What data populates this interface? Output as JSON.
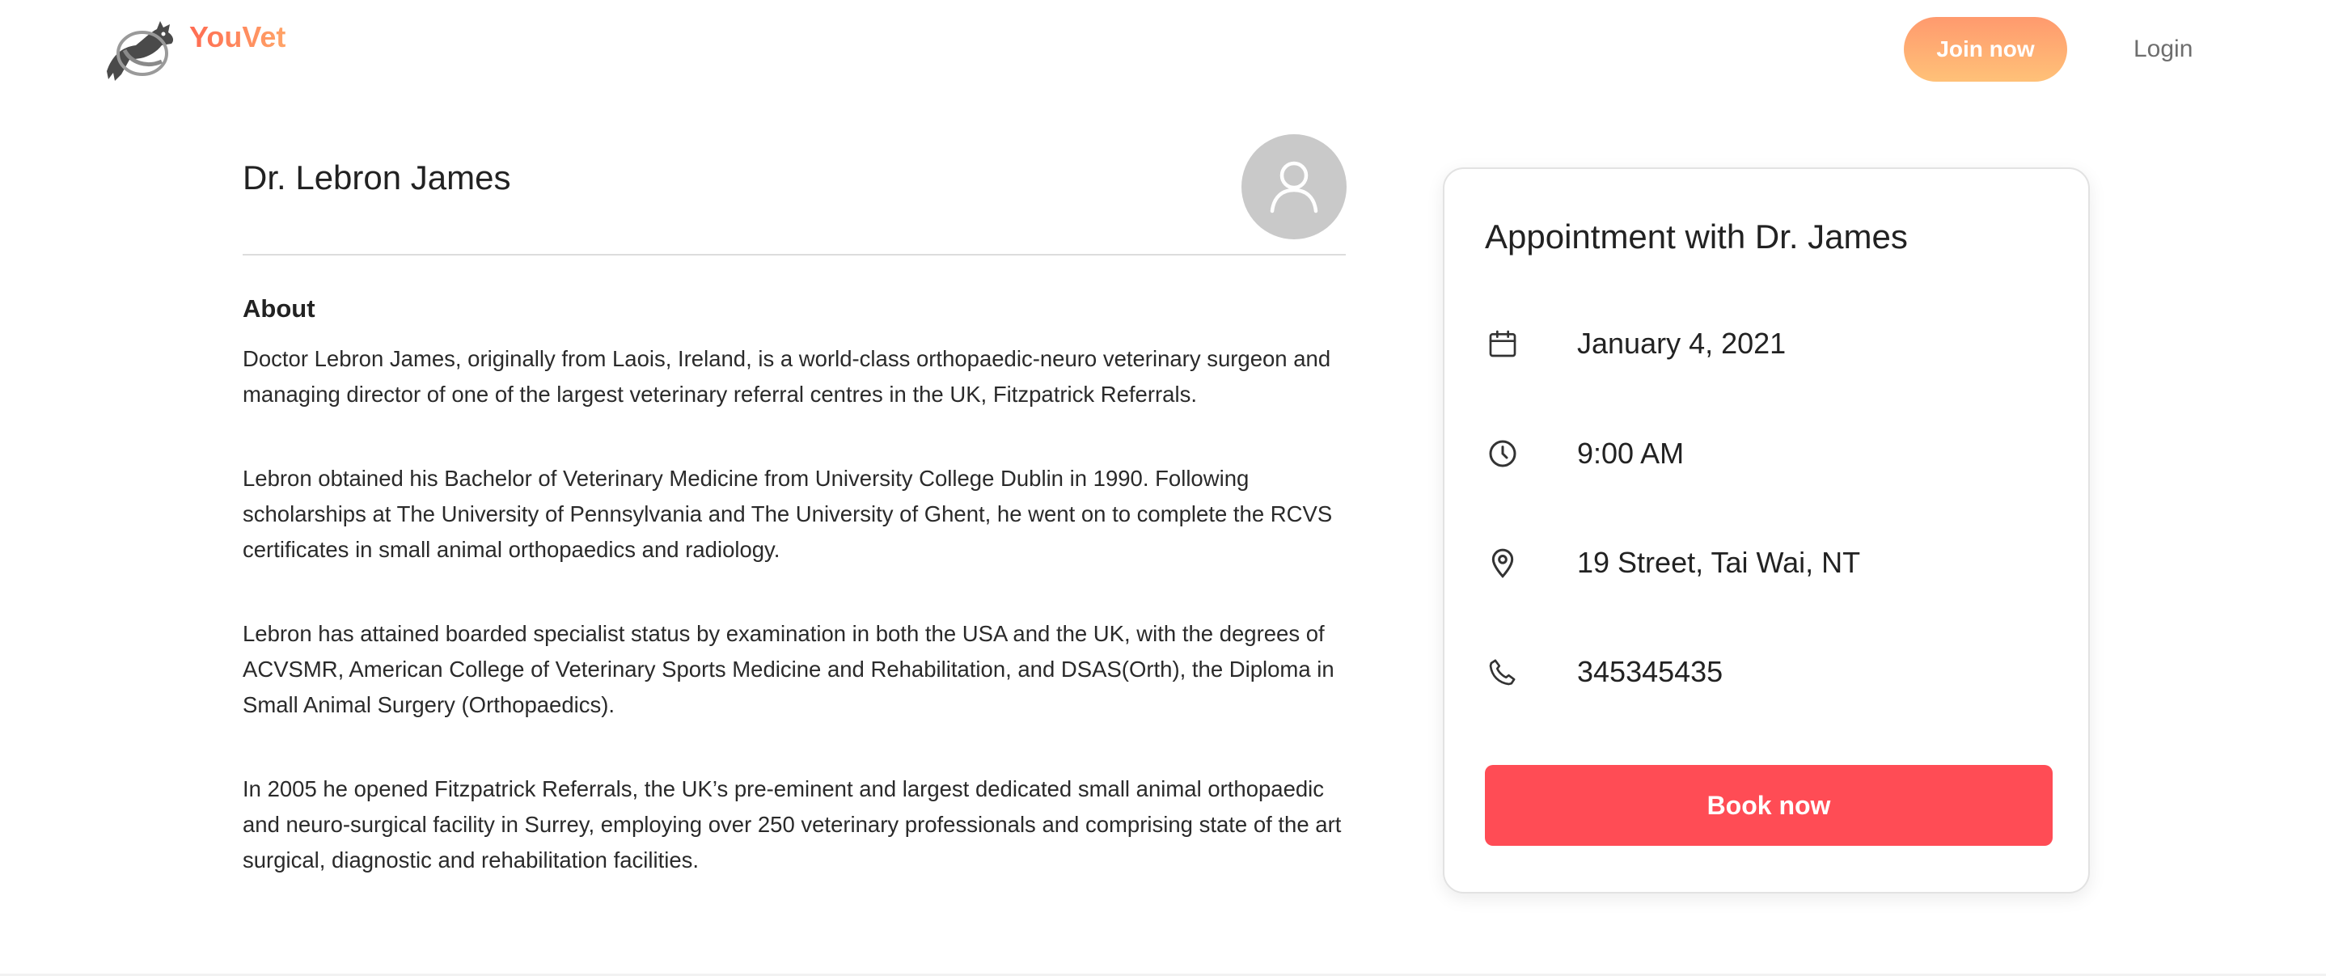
{
  "header": {
    "brand": "YouVet",
    "join_label": "Join now",
    "login_label": "Login"
  },
  "doctor": {
    "name": "Dr. Lebron James",
    "about_heading": "About",
    "about_paragraphs": [
      "Doctor Lebron James, originally from Laois, Ireland, is a world-class orthopaedic-neuro veterinary surgeon and managing director of one of the largest veterinary referral centres in the UK, Fitzpatrick Referrals.",
      "Lebron obtained his Bachelor of Veterinary Medicine from University College Dublin in 1990. Following scholarships at The University of Pennsylvania and The University of Ghent, he went on to complete the RCVS certificates in small animal orthopaedics and radiology.",
      "Lebron has attained boarded specialist status by examination in both the USA and the UK, with the degrees of ACVSMR, American College of Veterinary Sports Medicine and Rehabilitation, and DSAS(Orth), the Diploma in Small Animal Surgery (Orthopaedics).",
      "In 2005 he opened Fitzpatrick Referrals, the UK’s pre-eminent and largest dedicated small animal orthopaedic and neuro-surgical facility in Surrey, employing over 250 veterinary professionals and comprising state of the art surgical, diagnostic and rehabilitation facilities."
    ]
  },
  "appointment": {
    "title": "Appointment with Dr. James",
    "date": "January 4, 2021",
    "time": "9:00 AM",
    "location": "19 Street, Tai Wai, NT",
    "phone": "345345435",
    "book_label": "Book now",
    "icons": [
      "calendar-icon",
      "clock-icon",
      "location-pin-icon",
      "phone-icon"
    ]
  },
  "colors": {
    "brand_gradient": [
      "#ff6b52",
      "#ffa468"
    ],
    "join_gradient": [
      "#ff9a6e",
      "#ffc178"
    ],
    "book_button": "#ff4c55",
    "avatar_bg": "#c9c9c9"
  }
}
